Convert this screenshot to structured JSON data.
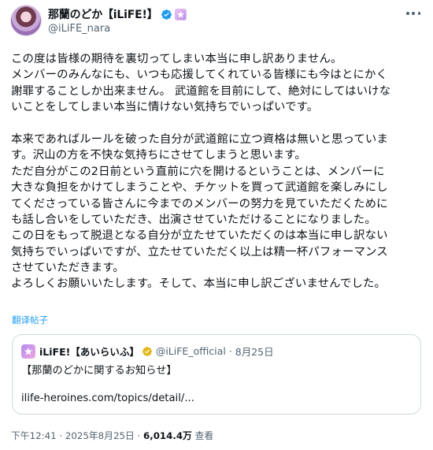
{
  "author": {
    "display_name": "那蘭のどか【iLiFE!】",
    "handle": "@iLiFE_nara"
  },
  "post": {
    "lines": [
      "この度は皆様の期待を裏切ってしまい本当に申し訳ありません。",
      "メンバーのみんなにも、いつも応援してくれている皆様にも今はとにかく",
      "謝罪することしか出来ません。 武道館を目前にして、絶対にしてはいけな",
      "いことをしてしまい本当に情けない気持ちでいっぱいです。",
      "",
      "本来であればルールを破った自分が武道館に立つ資格は無いと思っていま",
      "す。沢山の方を不快な気持ちにさせてしまうと思います。",
      "ただ自分がこの2日前という直前に穴を開けるということは、メンバーに",
      "大きな負担をかけてしまうことや、チケットを買って武道館を楽しみにし",
      "てくださっている皆さんに今までのメンバーの努力を見ていただくために",
      "も話し合いをしていただき、出演させていただけることになりました。",
      "この日をもって脱退となる自分が立たせていただくのは本当に申し訳ない",
      "気持ちでいっぱいですが、立たせていただく以上は精一杯パフォーマンス",
      "させていただきます。",
      "よろしくお願いいたします。そして、本当に申し訳ございませんでした。"
    ],
    "translate_label": "翻译帖子"
  },
  "quote": {
    "name": "iLiFE!【あいらいふ】",
    "handle": "@iLiFE_official",
    "separator": "·",
    "date": "8月25日",
    "title": "【那蘭のどかに関するお知らせ】",
    "link": "ilife-heroines.com/topics/detail/..."
  },
  "footer": {
    "time": "下午12:41",
    "separator": "·",
    "date": "2025年8月25日",
    "views_count": "6,014.4万",
    "views_label": "查看"
  },
  "colors": {
    "text": "#0f1419",
    "secondary": "#536471",
    "link": "#1d9bf0",
    "verified_blue": "#1d9bf0",
    "verified_gold": "#e2b719",
    "border": "#cfd9de"
  }
}
